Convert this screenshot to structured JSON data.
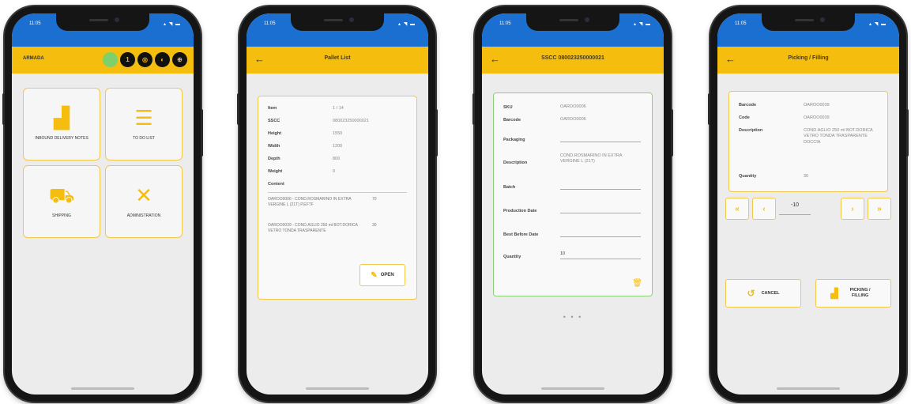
{
  "status": {
    "time": "11:05",
    "icons": "▴ ◥ ▬"
  },
  "phone1": {
    "brand": "ARMADA",
    "circles": [
      "",
      "1",
      "◎",
      "◐",
      "⊕"
    ],
    "tiles": [
      {
        "label": "INBOUND DELIVERY NOTES",
        "icon": "hand-truck-icon",
        "glyph": "▟"
      },
      {
        "label": "TO DO LIST",
        "icon": "list-icon",
        "glyph": "☰"
      },
      {
        "label": "SHIPPING",
        "icon": "truck-icon",
        "glyph": "⛟"
      },
      {
        "label": "ADMINISTRATION",
        "icon": "tools-icon",
        "glyph": "✕"
      }
    ]
  },
  "phone2": {
    "title": "Pallet List",
    "fields": [
      {
        "k": "Item",
        "v": "1 / 14"
      },
      {
        "k": "SSCC",
        "v": "080023250000021"
      },
      {
        "k": "Height",
        "v": "1550"
      },
      {
        "k": "Width",
        "v": "1200"
      },
      {
        "k": "Depth",
        "v": "800"
      },
      {
        "k": "Weight",
        "v": "0"
      },
      {
        "k": "Content",
        "v": ""
      }
    ],
    "content": [
      {
        "text": "OAROO0006 - COND.ROSMARINO IN EXTRA VERGINE L (21T) P.EFTF",
        "qty": "70"
      },
      {
        "text": "OAROO0039 - COND.AGLIO 250 ml BOT.DORICA VETRO TONDA TRASPARENTE",
        "qty": "30"
      }
    ],
    "open_label": "OPEN"
  },
  "phone3": {
    "title": "SSCC 080023250000021",
    "fields": [
      {
        "k": "SKU",
        "v": "OAROO0006",
        "type": "plain"
      },
      {
        "k": "Barcode",
        "v": "OAROO0006",
        "type": "plain"
      },
      {
        "k": "Packaging",
        "v": "",
        "type": "field"
      },
      {
        "k": "Description",
        "v": "COND.ROSMARINO IN EXTRA VERGINE L (21T)",
        "type": "plain"
      },
      {
        "k": "Batch",
        "v": "",
        "type": "field"
      },
      {
        "k": "Production Date",
        "v": "",
        "type": "field"
      },
      {
        "k": "Best Before Date",
        "v": "",
        "type": "field"
      },
      {
        "k": "Quantity",
        "v": "10",
        "type": "field"
      }
    ],
    "pager": "• • •"
  },
  "phone4": {
    "title": "Picking / Filling",
    "fields": [
      {
        "k": "Barcode",
        "v": "OAROO0039"
      },
      {
        "k": "Code",
        "v": "OAROO0039"
      },
      {
        "k": "Description",
        "v": "COND.AGLIO 250 ml BOT.DORICA VETRO TONDA TRASPARENTE DOCCIA"
      },
      {
        "k": "Quantity",
        "v": "30"
      }
    ],
    "nav": {
      "first": "«",
      "prev": "‹",
      "qty": "-10",
      "next": "›",
      "last": "»"
    },
    "cancel_label": "CANCEL",
    "picking_label": "PICKING / FILLING"
  }
}
